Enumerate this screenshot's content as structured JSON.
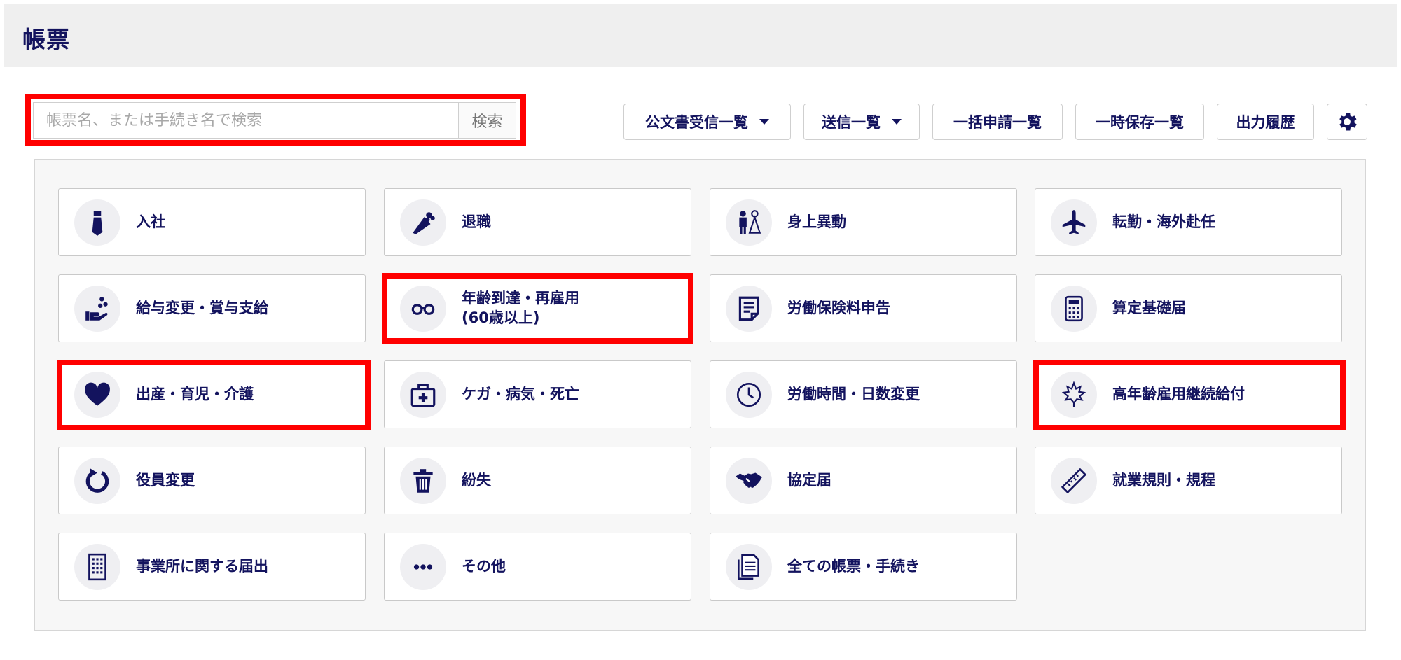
{
  "header": {
    "title": "帳票"
  },
  "search": {
    "placeholder": "帳票名、または手続き名で検索",
    "button_label": "検索"
  },
  "toolbar": {
    "received_docs": "公文書受信一覧",
    "sent_list": "送信一覧",
    "bulk_apply": "一括申請一覧",
    "temp_saved": "一時保存一覧",
    "output_history": "出力履歴",
    "settings_icon": "gear-icon"
  },
  "categories": [
    {
      "label": "入社",
      "icon": "necktie-icon"
    },
    {
      "label": "退職",
      "icon": "bouquet-icon"
    },
    {
      "label": "身上異動",
      "icon": "couple-icon"
    },
    {
      "label": "転勤・海外赴任",
      "icon": "airplane-icon"
    },
    {
      "label": "給与変更・賞与支給",
      "icon": "hand-coins-icon"
    },
    {
      "label": "年齢到達・再雇用\n(60歳以上)",
      "icon": "glasses-icon"
    },
    {
      "label": "労働保険料申告",
      "icon": "document-icon"
    },
    {
      "label": "算定基礎届",
      "icon": "calculator-icon"
    },
    {
      "label": "出産・育児・介護",
      "icon": "heart-icon"
    },
    {
      "label": "ケガ・病気・死亡",
      "icon": "first-aid-icon"
    },
    {
      "label": "労働時間・日数変更",
      "icon": "clock-icon"
    },
    {
      "label": "高年齢雇用継続給付",
      "icon": "maple-leaf-icon"
    },
    {
      "label": "役員変更",
      "icon": "refresh-icon"
    },
    {
      "label": "紛失",
      "icon": "trash-icon"
    },
    {
      "label": "協定届",
      "icon": "handshake-icon"
    },
    {
      "label": "就業規則・規程",
      "icon": "ruler-icon"
    },
    {
      "label": "事業所に関する届出",
      "icon": "building-icon"
    },
    {
      "label": "その他",
      "icon": "more-icon"
    },
    {
      "label": "全ての帳票・手続き",
      "icon": "documents-icon"
    }
  ],
  "colors": {
    "accent": "#13135e",
    "highlight": "#ff0000",
    "header_bg": "#efefef"
  }
}
